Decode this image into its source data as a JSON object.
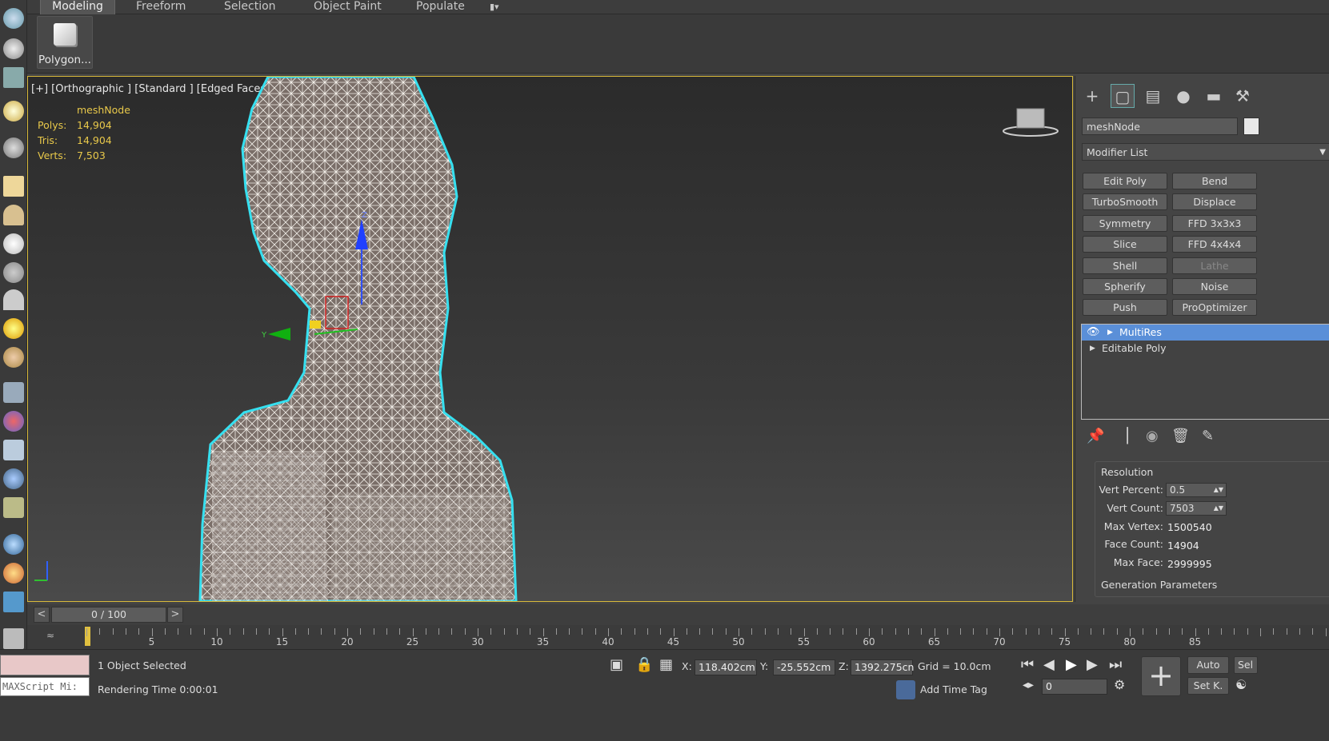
{
  "ribbon": {
    "tabs": [
      "Modeling",
      "Freeform",
      "Selection",
      "Object Paint",
      "Populate"
    ],
    "polygon_button": "Polygon..."
  },
  "viewport": {
    "label": "[+] [Orthographic ] [Standard ] [Edged Faces ]",
    "stats": {
      "object": "meshNode",
      "polys_label": "Polys:",
      "polys": "14,904",
      "tris_label": "Tris:",
      "tris": "14,904",
      "verts_label": "Verts:",
      "verts": "7,503"
    },
    "axis_z": "Z",
    "axis_y": "Y"
  },
  "command_panel": {
    "object_name": "meshNode",
    "modifier_list": "Modifier List",
    "modifier_buttons": [
      "Edit Poly",
      "Bend",
      "TurboSmooth",
      "Displace",
      "Symmetry",
      "FFD 3x3x3",
      "Slice",
      "FFD 4x4x4",
      "Shell",
      "Lathe",
      "Spherify",
      "Noise",
      "Push",
      "ProOptimizer"
    ],
    "stack": [
      "MultiRes",
      "Editable Poly"
    ],
    "resolution": {
      "title": "Resolution",
      "vert_percent_label": "Vert Percent:",
      "vert_percent": "0.5",
      "vert_count_label": "Vert Count:",
      "vert_count": "7503",
      "max_vertex_label": "Max Vertex:",
      "max_vertex": "1500540",
      "face_count_label": "Face Count:",
      "face_count": "14904",
      "max_face_label": "Max Face:",
      "max_face": "2999995"
    },
    "generation_title": "Generation Parameters"
  },
  "timeline": {
    "frame": "0 / 100",
    "prev": "<",
    "next": ">",
    "ticks": [
      "5",
      "10",
      "15",
      "20",
      "25",
      "30",
      "35",
      "40",
      "45",
      "50",
      "55",
      "60",
      "65",
      "70",
      "75",
      "80",
      "85"
    ]
  },
  "status": {
    "maxscript": "MAXScript Mi:",
    "selected": "1 Object Selected",
    "render_time": "Rendering Time  0:00:01",
    "x_label": "X:",
    "x": "118.402cm",
    "y_label": "Y:",
    "y": "-25.552cm",
    "z_label": "Z:",
    "z": "1392.275cn",
    "grid": "Grid = 10.0cm",
    "add_time_tag": "Add Time Tag",
    "frame_field": "0",
    "auto": "Auto",
    "set_key": "Set K.",
    "sel": "Sel"
  }
}
